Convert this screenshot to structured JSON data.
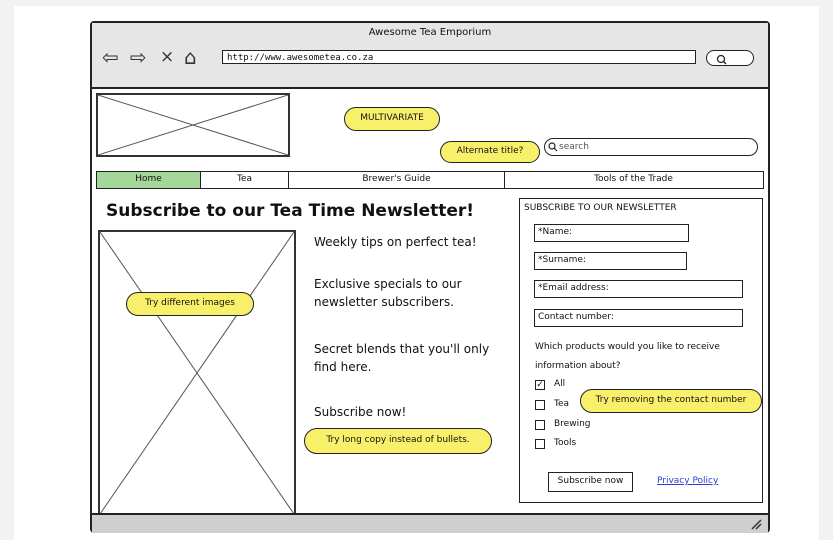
{
  "window": {
    "title": "Awesome Tea Emporium"
  },
  "browser": {
    "back_icon": "⇦",
    "forward_icon": "⇨",
    "close_icon": "×",
    "home_icon": "⌂",
    "url": "http://www.awesometea.co.za"
  },
  "notes": {
    "multivariate": "MULTIVARIATE",
    "alt_title": "Alternate title?",
    "images": "Try different images",
    "long_copy": "Try long copy instead of bullets.",
    "contact": "Try removing the contact number"
  },
  "search": {
    "placeholder": "search"
  },
  "nav": [
    "Home",
    "Tea",
    "Brewer's Guide",
    "Tools of the Trade"
  ],
  "colors": {
    "nav_active": "#a6d79a",
    "sticky": "#f8ef6a",
    "link": "#2a3fd6"
  },
  "main": {
    "headline": "Subscribe to our Tea Time Newsletter!",
    "bullets": [
      "Weekly tips on perfect tea!",
      "Exclusive specials to our newsletter subscribers.",
      "Secret blends that you'll only find here.",
      "Subscribe now!"
    ]
  },
  "form": {
    "title": "SUBSCRIBE TO OUR NEWSLETTER",
    "fields": [
      "*Name:",
      "*Surname:",
      "*Email address:",
      "Contact number:"
    ],
    "question": "Which products would you like to receive information about?",
    "options": [
      {
        "label": "All",
        "checked": true
      },
      {
        "label": "Tea",
        "checked": false
      },
      {
        "label": "Brewing",
        "checked": false
      },
      {
        "label": "Tools",
        "checked": false
      }
    ],
    "check_mark": "✓",
    "submit": "Subscribe now",
    "privacy": "Privacy Policy"
  }
}
